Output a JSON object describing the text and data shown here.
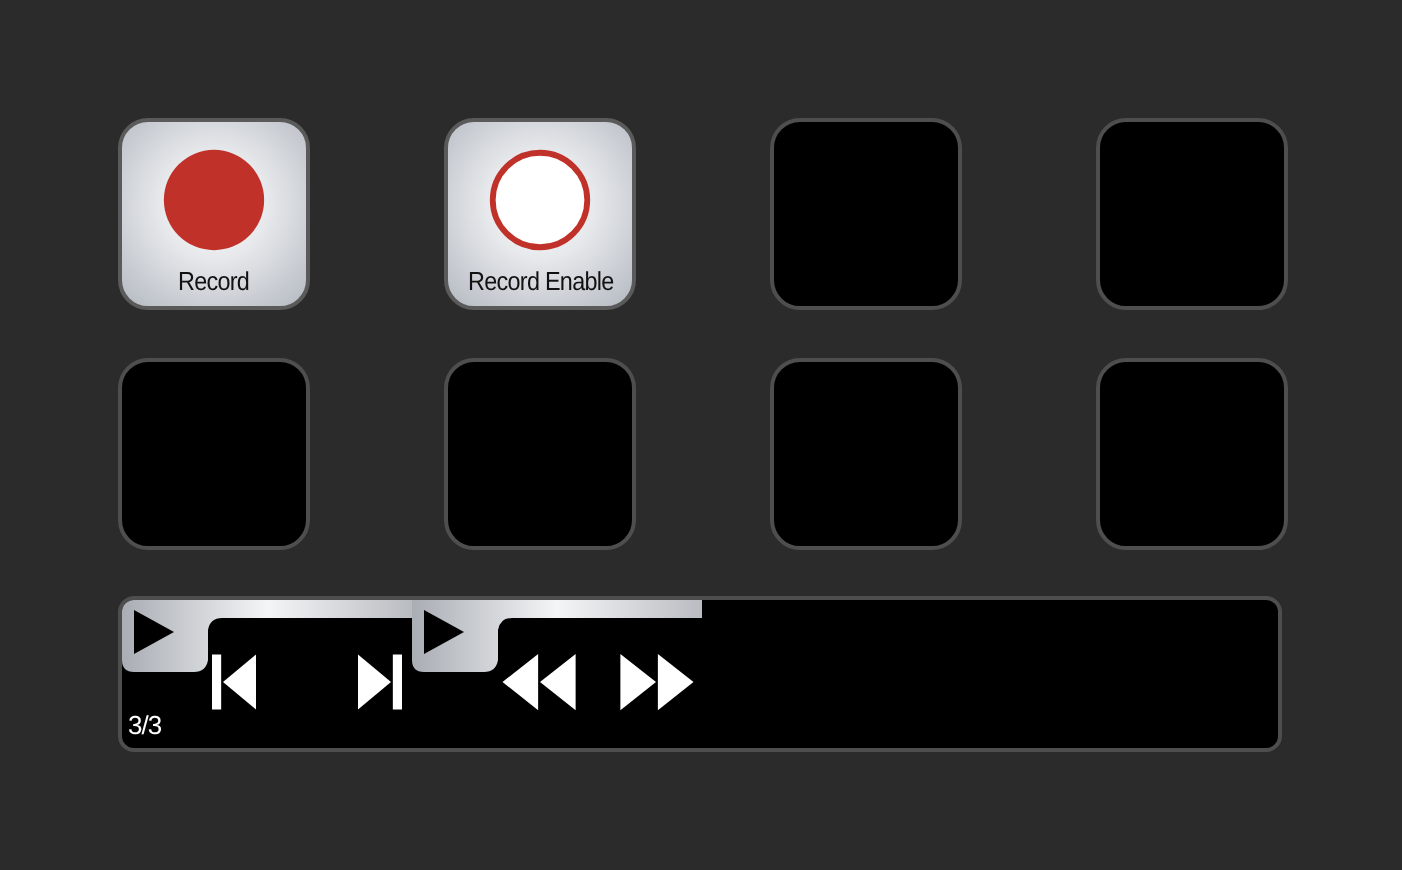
{
  "keys": [
    {
      "kind": "record",
      "label": "Record"
    },
    {
      "kind": "record-enable",
      "label": "Record Enable"
    },
    {
      "kind": "empty"
    },
    {
      "kind": "empty"
    },
    {
      "kind": "empty"
    },
    {
      "kind": "empty"
    },
    {
      "kind": "empty"
    },
    {
      "kind": "empty"
    }
  ],
  "strip": {
    "page": "3/3",
    "segments": [
      {
        "controls": [
          {
            "kind": "skip-back"
          },
          {
            "kind": "skip-forward"
          }
        ]
      },
      {
        "controls": [
          {
            "kind": "rewind"
          },
          {
            "kind": "fast-forward"
          }
        ]
      }
    ]
  }
}
